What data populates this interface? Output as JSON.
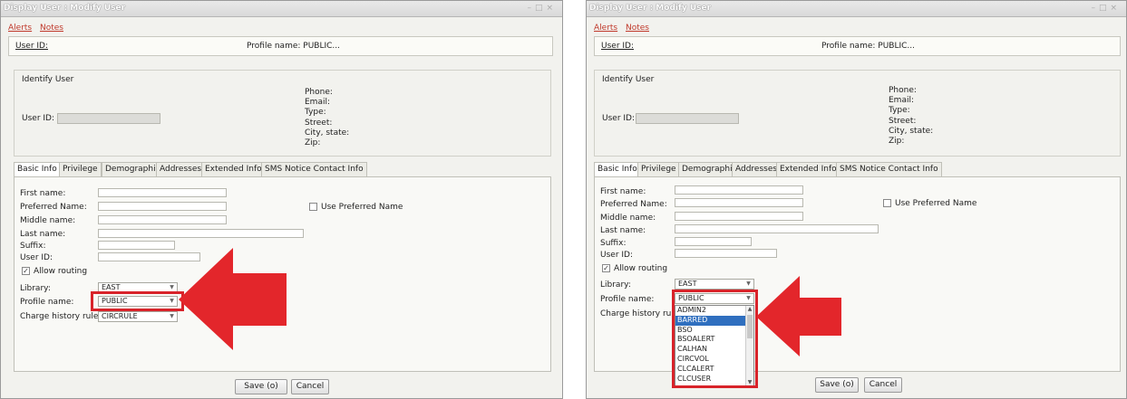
{
  "left": {
    "title": "Display User : Modify User",
    "links": [
      "Alerts",
      "Notes"
    ],
    "header": {
      "user_id_label": "User ID:",
      "profile_text": "Profile name: PUBLIC..."
    },
    "identify": {
      "title": "Identify User",
      "user_id_label": "User ID:",
      "contact_labels": [
        "Phone:",
        "Email:",
        "Type:",
        "Street:",
        "City, state:",
        "Zip:"
      ]
    },
    "tabs": [
      "Basic Info",
      "Privilege",
      "Demographics",
      "Addresses",
      "Extended Info",
      "SMS Notice Contact Info"
    ],
    "form": {
      "labels": [
        "First name:",
        "Preferred Name:",
        "Middle name:",
        "Last name:",
        "Suffix:",
        "User ID:"
      ],
      "use_preferred": "Use Preferred Name",
      "allow_routing": "Allow routing",
      "library_label": "Library:",
      "library_value": "EAST",
      "profile_label": "Profile name:",
      "profile_value": "PUBLIC",
      "charge_label": "Charge history rule:",
      "charge_value": "CIRCRULE"
    },
    "buttons": {
      "save": "Save (o)",
      "cancel": "Cancel"
    }
  },
  "right": {
    "title": "Display User : Modify User",
    "links": [
      "Alerts",
      "Notes"
    ],
    "header": {
      "user_id_label": "User ID:",
      "profile_text": "Profile name: PUBLIC..."
    },
    "identify": {
      "title": "Identify User",
      "user_id_label": "User ID:",
      "contact_labels": [
        "Phone:",
        "Email:",
        "Type:",
        "Street:",
        "City, state:",
        "Zip:"
      ]
    },
    "tabs": [
      "Basic Info",
      "Privilege",
      "Demographics",
      "Addresses",
      "Extended Info",
      "SMS Notice Contact Info"
    ],
    "form": {
      "labels": [
        "First name:",
        "Preferred Name:",
        "Middle name:",
        "Last name:",
        "Suffix:",
        "User ID:"
      ],
      "use_preferred": "Use Preferred Name",
      "allow_routing": "Allow routing",
      "library_label": "Library:",
      "library_value": "EAST",
      "profile_label": "Profile name:",
      "profile_value": "PUBLIC",
      "charge_label": "Charge history rule:"
    },
    "dropdown_options": [
      "ADMIN2",
      "BARRED",
      "BSO",
      "BSOALERT",
      "CALHAN",
      "CIRCVOL",
      "CLCALERT",
      "CLCUSER"
    ],
    "dropdown_highlighted": "BARRED",
    "buttons": {
      "save": "Save (o)",
      "cancel": "Cancel"
    }
  },
  "colors": {
    "highlight": "#d8232a",
    "link": "#c0392b",
    "selection": "#2f6fbf"
  }
}
